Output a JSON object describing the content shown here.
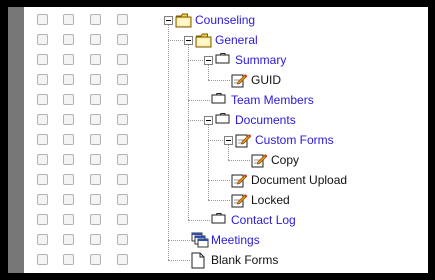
{
  "tree": {
    "rows": [
      {
        "label": "Counseling",
        "icon": "folder-open-icon",
        "link": true
      },
      {
        "label": "General",
        "icon": "folder-open-icon",
        "link": true
      },
      {
        "label": "Summary",
        "icon": "folder-closed-icon",
        "link": true
      },
      {
        "label": "GUID",
        "icon": "form-edit-icon",
        "link": false
      },
      {
        "label": "Team Members",
        "icon": "folder-closed-icon",
        "link": true
      },
      {
        "label": "Documents",
        "icon": "folder-closed-icon",
        "link": true
      },
      {
        "label": "Custom Forms",
        "icon": "form-edit-icon",
        "link": true
      },
      {
        "label": "Copy",
        "icon": "form-edit-icon",
        "link": false
      },
      {
        "label": "Document Upload",
        "icon": "form-edit-icon",
        "link": false
      },
      {
        "label": "Locked",
        "icon": "form-edit-icon",
        "link": false
      },
      {
        "label": "Contact Log",
        "icon": "folder-closed-icon",
        "link": true
      },
      {
        "label": "Meetings",
        "icon": "stacked-windows-icon",
        "link": true
      },
      {
        "label": "Blank Forms",
        "icon": "blank-document-icon",
        "link": false
      }
    ]
  },
  "colors": {
    "link": "#2a19d8",
    "text": "#111111",
    "folder": "#f5d240"
  }
}
